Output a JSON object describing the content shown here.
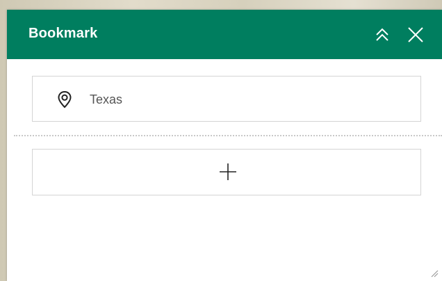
{
  "panel": {
    "title": "Bookmark",
    "header_color": "#007e5f"
  },
  "header_actions": {
    "collapse_icon": "double-chevron-up-icon",
    "close_icon": "close-icon"
  },
  "bookmarks": [
    {
      "label": "Texas",
      "icon": "map-pin-icon"
    }
  ],
  "add_button": {
    "icon": "plus-icon"
  },
  "resize_handle": {
    "icon": "resize-handle-icon"
  }
}
